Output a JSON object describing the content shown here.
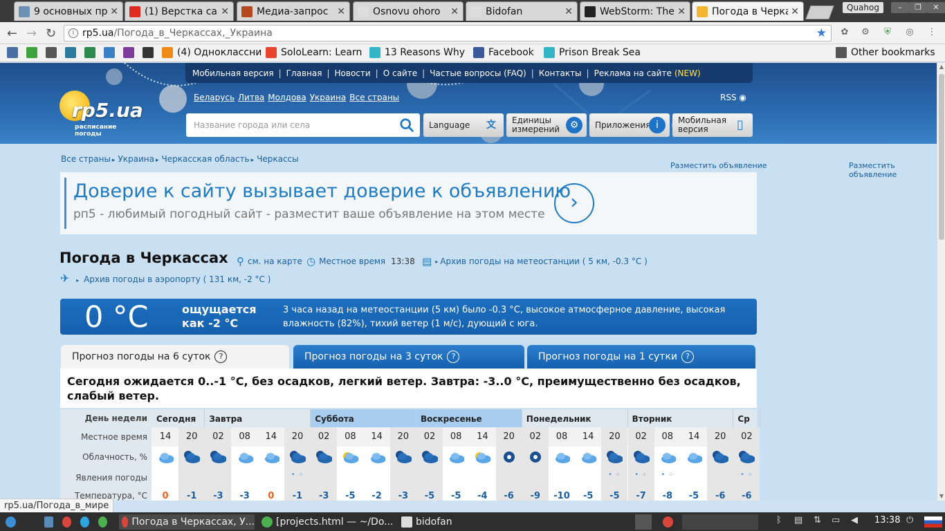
{
  "browser": {
    "tabs": [
      {
        "label": "9 основных пр",
        "active": false,
        "fav_color": "#6b8fb5"
      },
      {
        "label": "(1) Верстка сай",
        "active": false,
        "fav_color": "#e02a20"
      },
      {
        "label": "Медиа-запрос",
        "active": false,
        "fav_color": "#b5481f"
      },
      {
        "label": "Osnovu ohoro",
        "active": false,
        "fav_color": "#dddddd"
      },
      {
        "label": "Bidofan",
        "active": false,
        "fav_color": "#dddddd"
      },
      {
        "label": "WebStorm: The",
        "active": false,
        "fav_color": "#222222"
      },
      {
        "label": "Погода в Черка",
        "active": true,
        "fav_color": "#f2b630"
      }
    ],
    "profile_name": "Quahog",
    "url_host": "rp5.ua",
    "url_path": "/Погода_в_Черкассах,_Украина",
    "bookmarks": [
      {
        "label": "",
        "color": "#4a6fa5"
      },
      {
        "label": "",
        "color": "#3fa23f"
      },
      {
        "label": "",
        "color": "#555555"
      },
      {
        "label": "",
        "color": "#2c7a9c"
      },
      {
        "label": "",
        "color": "#2d8a4f"
      },
      {
        "label": "",
        "color": "#3b7fc4"
      },
      {
        "label": "",
        "color": "#7d3c9c"
      },
      {
        "label": "",
        "color": "#333333"
      },
      {
        "label": "(4) Одноклассни",
        "color": "#f08a16"
      },
      {
        "label": "SoloLearn: Learn",
        "color": "#e8452c"
      },
      {
        "label": "13 Reasons Why",
        "color": "#35b6c7"
      },
      {
        "label": "Facebook",
        "color": "#3b5998"
      },
      {
        "label": "Prison Break Sea",
        "color": "#35b6c7"
      }
    ],
    "other_bookmarks": "Other bookmarks",
    "status_url": "rp5.ua/Погода_в_мире"
  },
  "site": {
    "top_menu": [
      "Мобильная версия",
      "Главная",
      "Новости",
      "О сайте",
      "Частые вопросы (FAQ)",
      "Контакты",
      "Реклама на сайте"
    ],
    "top_menu_new": "(NEW)",
    "logo_text": "rp5.ua",
    "logo_sub1": "расписание",
    "logo_sub2": "погоды",
    "countries": [
      "Беларусь",
      "Литва",
      "Молдова",
      "Украина",
      "Все страны"
    ],
    "rss": "RSS",
    "search_placeholder": "Название города или села",
    "buttons": {
      "language": "Language",
      "units_1": "Единицы",
      "units_2": "измерений",
      "apps": "Приложения",
      "mobile_1": "Мобильная",
      "mobile_2": "версия"
    }
  },
  "breadcrumbs": [
    "Все страны",
    "Украина",
    "Черкасская область",
    "Черкассы"
  ],
  "ad_link": "Разместить объявление",
  "banner": {
    "title": "Доверие к сайту вызывает доверие к объявлению",
    "subtitle": "рп5 - любимый погодный сайт - разместит ваше объявление на этом месте"
  },
  "city_title": "Погода в Черкассах",
  "map_link": "см. на карте",
  "local_time_label": "Местное время",
  "local_time": "13:38",
  "archive_station": "Архив погоды на метеостанции ( 5 км, -0.3 °C )",
  "archive_airport": "Архив погоды в аэропорту ( 131 км, -2 °C )",
  "current": {
    "temp": "0 °C",
    "feels_1": "ощущается",
    "feels_2": "как -2 °C",
    "description": "3 часа назад на метеостанции (5 км) было -0.3 °C, высокое атмосферное давление, высокая влажность (82%), тихий ветер (1 м/с), дующий с юга."
  },
  "forecast_tabs": [
    "Прогноз погоды на 6 суток",
    "Прогноз погоды на 3 суток",
    "Прогноз погоды на 1 сутки"
  ],
  "help_icon": "?",
  "summary": "Сегодня ожидается 0..-1 °C, без осадков, легкий ветер. Завтра: -3..0 °C, преимущественно без осадков, слабый ветер.",
  "table": {
    "row_labels": [
      "День недели",
      "Местное время",
      "Облачность, %",
      "Явления погоды",
      "Температура, °C"
    ],
    "days": [
      "Сегодня",
      "Завтра",
      "Суббота",
      "Воскресенье",
      "Понедельник",
      "Вторник",
      "Ср"
    ],
    "hours": [
      "14",
      "20",
      "02",
      "08",
      "14",
      "20",
      "02",
      "08",
      "14",
      "20",
      "02",
      "08",
      "14",
      "20",
      "02",
      "08",
      "14",
      "20",
      "02",
      "08",
      "14",
      "20",
      "02"
    ],
    "temps": [
      "0",
      "-1",
      "-3",
      "-3",
      "0",
      "-1",
      "-3",
      "-5",
      "-2",
      "-3",
      "-5",
      "-5",
      "-4",
      "-6",
      "-9",
      "-10",
      "-5",
      "-5",
      "-7",
      "-8",
      "-5",
      "-6",
      "-6"
    ],
    "icons": [
      "partly-cloudy-day-icon",
      "cloudy-night-icon",
      "cloudy-night-icon",
      "partly-cloudy-day-icon",
      "cloudy-day-icon",
      "cloudy-night-icon",
      "partly-cloudy-night-icon",
      "sunny-cloud-icon",
      "cloudy-day-icon",
      "cloudy-night-icon",
      "cloudy-night-icon",
      "cloudy-day-icon",
      "sunny-cloud-icon",
      "clear-night-icon",
      "clear-night-icon",
      "partly-cloudy-day-icon",
      "cloudy-day-icon",
      "cloudy-night-icon",
      "cloudy-night-icon",
      "partly-cloudy-day-icon",
      "cloudy-day-icon",
      "cloudy-night-icon",
      "cloudy-night-icon"
    ],
    "snow": [
      false,
      false,
      false,
      false,
      false,
      true,
      false,
      false,
      false,
      false,
      false,
      false,
      false,
      false,
      false,
      false,
      false,
      true,
      true,
      true,
      false,
      false,
      true
    ]
  },
  "taskbar": {
    "items": [
      "Погода в Черкассах, У...",
      "[projects.html — ~/Do...",
      "bidofan"
    ],
    "clock": "13:38"
  },
  "colors": {
    "accent": "#1d7ac3",
    "header_dark": "#163a6b",
    "link": "#1a5ea1",
    "temp_positive": "#e8601c"
  }
}
